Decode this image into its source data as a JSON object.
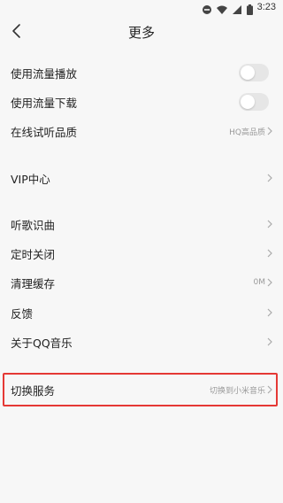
{
  "status_bar": {
    "time": "3:23",
    "icons": [
      "do-not-disturb-icon",
      "wifi-icon",
      "signal-icon",
      "battery-icon"
    ]
  },
  "header": {
    "title": "更多",
    "back_icon": "chevron-left-icon"
  },
  "settings": {
    "mobile_data_playback": {
      "label": "使用流量播放",
      "enabled": false
    },
    "mobile_data_download": {
      "label": "使用流量下载",
      "enabled": false
    },
    "online_quality": {
      "label": "在线试听品质",
      "value": "HQ高品质"
    },
    "vip_center": {
      "label": "VIP中心"
    },
    "song_recognition": {
      "label": "听歌识曲"
    },
    "sleep_timer": {
      "label": "定时关闭"
    },
    "clear_cache": {
      "label": "清理缓存",
      "value": "0M"
    },
    "feedback": {
      "label": "反馈"
    },
    "about": {
      "label": "关于QQ音乐"
    },
    "switch_service": {
      "label": "切换服务",
      "value": "切换到小米音乐"
    }
  },
  "colors": {
    "background": "#f7f7f7",
    "text": "#222222",
    "secondary_text": "#9a9a9a",
    "toggle_off": "#e6e6e6",
    "highlight": "#e53935"
  }
}
